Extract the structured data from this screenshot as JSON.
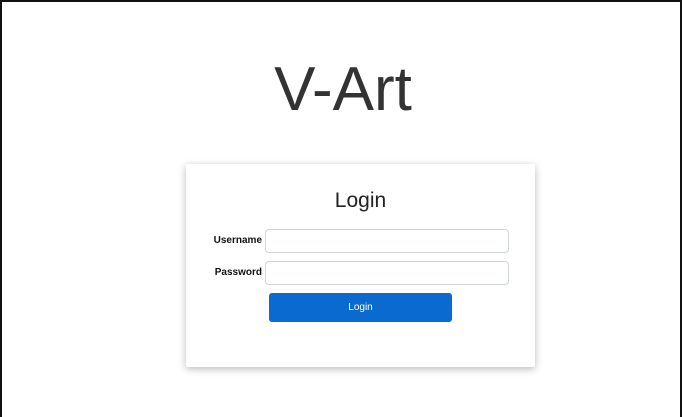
{
  "app": {
    "title": "V-Art"
  },
  "login_card": {
    "title": "Login",
    "username": {
      "label": "Username",
      "value": "",
      "placeholder": ""
    },
    "password": {
      "label": "Password",
      "value": "",
      "placeholder": ""
    },
    "submit_label": "Login"
  },
  "colors": {
    "button_background": "#0b6ad0",
    "button_text": "#ffffff",
    "title_text": "#333333"
  }
}
